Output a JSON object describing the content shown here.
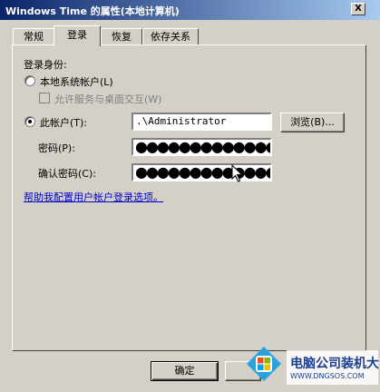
{
  "window": {
    "title": "Windows Time 的属性(本地计算机)",
    "close_label": "X"
  },
  "tabs": [
    {
      "label": "常规"
    },
    {
      "label": "登录",
      "active": true
    },
    {
      "label": "恢复"
    },
    {
      "label": "依存关系"
    }
  ],
  "logon": {
    "section_label": "登录身份:",
    "local_system_label": "本地系统帐户(L)",
    "allow_desktop_label": "允许服务与桌面交互(W)",
    "this_account_label": "此帐户(T):",
    "account_value": ".\\Administrator",
    "browse_label": "浏览(B)...",
    "password_label": "密码(P):",
    "password_value": "●●●●●●●●●●●●●●●",
    "confirm_label": "确认密码(C):",
    "confirm_value": "●●●●●●●●●●●●●●●",
    "help_link": "帮助我配置用户帐户登录选项。",
    "selected": "this_account"
  },
  "footer": {
    "ok_label": "确定"
  },
  "watermark": {
    "brand": "电脑公司装机大师",
    "url": "WWW.DNGSOS.COM",
    "icon": "windows-logo-icon"
  },
  "colors": {
    "title_start": "#0a246a",
    "title_end": "#a6caf0",
    "face": "#d4d0c8",
    "link": "#0000cc"
  }
}
